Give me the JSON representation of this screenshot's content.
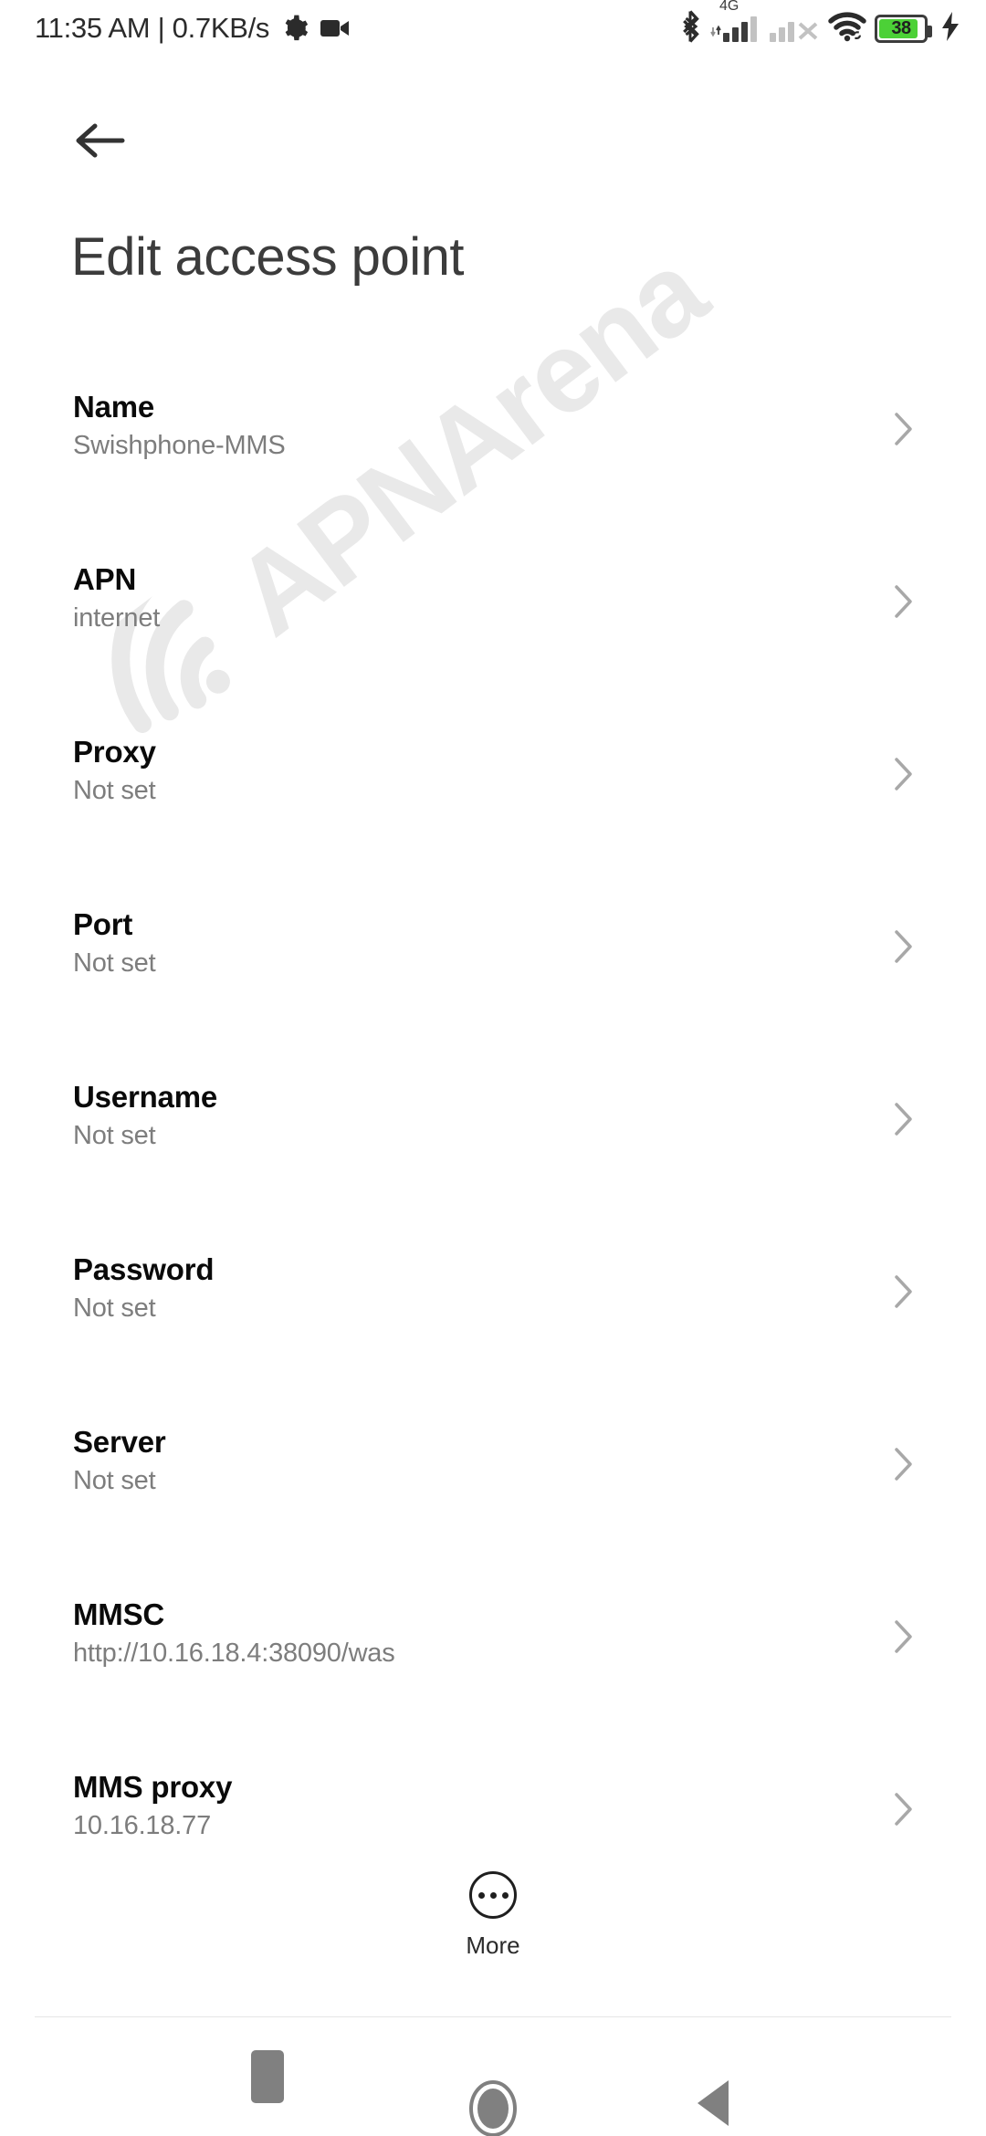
{
  "status_bar": {
    "time": "11:35 AM",
    "separator": "|",
    "data_rate": "0.7KB/s",
    "clock_text": "11:35 AM | 0.7KB/s",
    "left_icons": [
      "gear-icon",
      "video-camera-icon"
    ],
    "right_icons": [
      "bluetooth-icon",
      "signal-4g-icon",
      "signal-no-service-icon",
      "wifi-icon",
      "battery-icon",
      "charging-bolt-icon"
    ],
    "network_type": "4G",
    "battery_level": "38",
    "battery_color": "#4cd137",
    "charging": true
  },
  "navigation": {
    "back_label": "Back",
    "back_icon": "arrow-left-icon"
  },
  "header": {
    "title": "Edit access point"
  },
  "watermark": {
    "text": "APNArena",
    "color": "#e9e9e9",
    "logo": "wifi-arc-icon"
  },
  "settings_list": {
    "chevron_icon": "chevron-right-icon",
    "rows": [
      {
        "label": "Name",
        "value": "Swishphone-MMS"
      },
      {
        "label": "APN",
        "value": "internet"
      },
      {
        "label": "Proxy",
        "value": "Not set"
      },
      {
        "label": "Port",
        "value": "Not set"
      },
      {
        "label": "Username",
        "value": "Not set"
      },
      {
        "label": "Password",
        "value": "Not set"
      },
      {
        "label": "Server",
        "value": "Not set"
      },
      {
        "label": "MMSC",
        "value": "http://10.16.18.4:38090/was"
      },
      {
        "label": "MMS proxy",
        "value": "10.16.18.77"
      }
    ]
  },
  "more_button": {
    "label": "More",
    "icon": "three-dots-circle-icon"
  },
  "system_nav": {
    "recents_label": "Recents",
    "home_label": "Home",
    "back_label": "Back",
    "color": "#808080"
  }
}
